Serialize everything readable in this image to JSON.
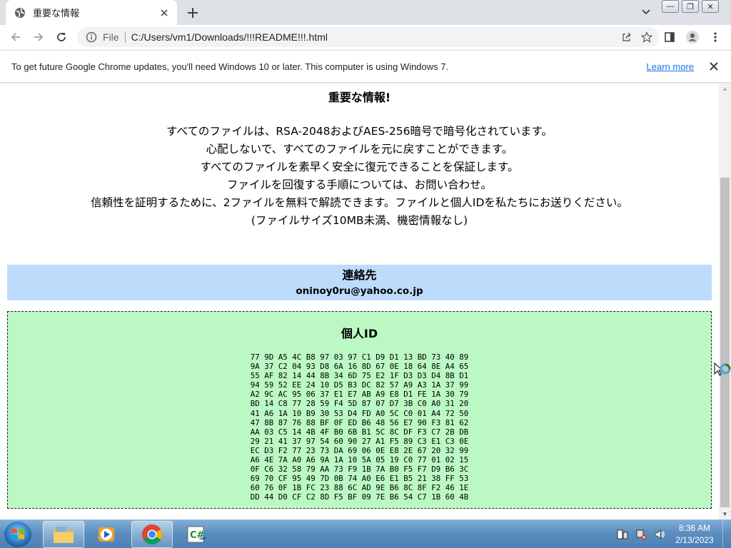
{
  "browser": {
    "tab": {
      "title": "重要な情報"
    },
    "window_controls": {
      "minimize": "—",
      "restore": "❐",
      "close": "✕"
    },
    "address_bar": {
      "scheme_label": "File",
      "url": "C:/Users/vm1/Downloads/!!!README!!!.html"
    },
    "infobar": {
      "message": "To get future Google Chrome updates, you'll need Windows 10 or later. This computer is using Windows 7.",
      "link": "Learn more"
    }
  },
  "page": {
    "title": "重要な情報!",
    "lines": [
      "すべてのファイルは、RSA-2048およびAES-256暗号で暗号化されています。",
      "心配しないで、すべてのファイルを元に戻すことができます。",
      "すべてのファイルを素早く安全に復元できることを保証します。",
      "ファイルを回復する手順については、お問い合わせ。",
      "信頼性を証明するために、2ファイルを無料で解読できます。ファイルと個人IDを私たちにお送りください。",
      "(ファイルサイズ10MB未満、機密情報なし)"
    ],
    "contact": {
      "title": "連絡先",
      "email": "oninoy0ru@yahoo.co.jp"
    },
    "personal_id": {
      "title": "個人ID",
      "hex": "77 9D A5 4C B8 97 03 97 C1 D9 D1 13 BD 73 40 89\n9A 37 C2 04 93 D8 6A 16 8D 67 0E 18 64 8E A4 65\n55 AF 82 14 44 8B 34 6D 75 E2 1F D3 D3 D4 8B D1\n94 59 52 EE 24 10 D5 B3 DC 82 57 A9 A3 1A 37 99\nA2 9C AC 95 06 37 E1 E7 AB A9 E8 D1 FE 1A 30 79\nBD 14 C8 77 28 59 F4 5D 87 07 D7 3B C0 A0 31 20\n41 A6 1A 10 B9 30 53 D4 FD A0 5C C0 01 A4 72 50\n47 8B 87 76 88 BF 0F ED B6 48 56 E7 90 F3 81 62\nAA 03 C5 14 4B 4F B0 6B B1 5C 8C DF F3 C7 2B DB\n29 21 41 37 97 54 60 90 27 A1 F5 89 C3 E1 C3 0E\nEC D3 F2 77 23 73 DA 69 06 0E E8 2E 67 20 32 99\nA6 4E 7A A0 A6 9A 1A 10 5A 05 19 C0 77 01 02 15\n0F C6 32 58 79 AA 73 F9 1B 7A B0 F5 F7 D9 B6 3C\n69 70 CF 95 49 7D 0B 74 A0 E6 E1 B5 21 38 FF 53\n60 76 0F 1B FC 23 88 6C AD 9E B6 8C 8F F2 46 1E\nDD 44 D0 CF C2 8D F5 BF 09 7E B6 54 C7 1B 60 4B"
    }
  },
  "taskbar": {
    "apps": [
      "windows-explorer",
      "media-player",
      "google-chrome",
      "csharp-app"
    ],
    "clock": {
      "time": "8:36 AM",
      "date": "2/13/2023"
    }
  },
  "colors": {
    "contact_bg": "#bddcfc",
    "id_bg": "#bbf8c3",
    "link": "#1a73e8"
  }
}
